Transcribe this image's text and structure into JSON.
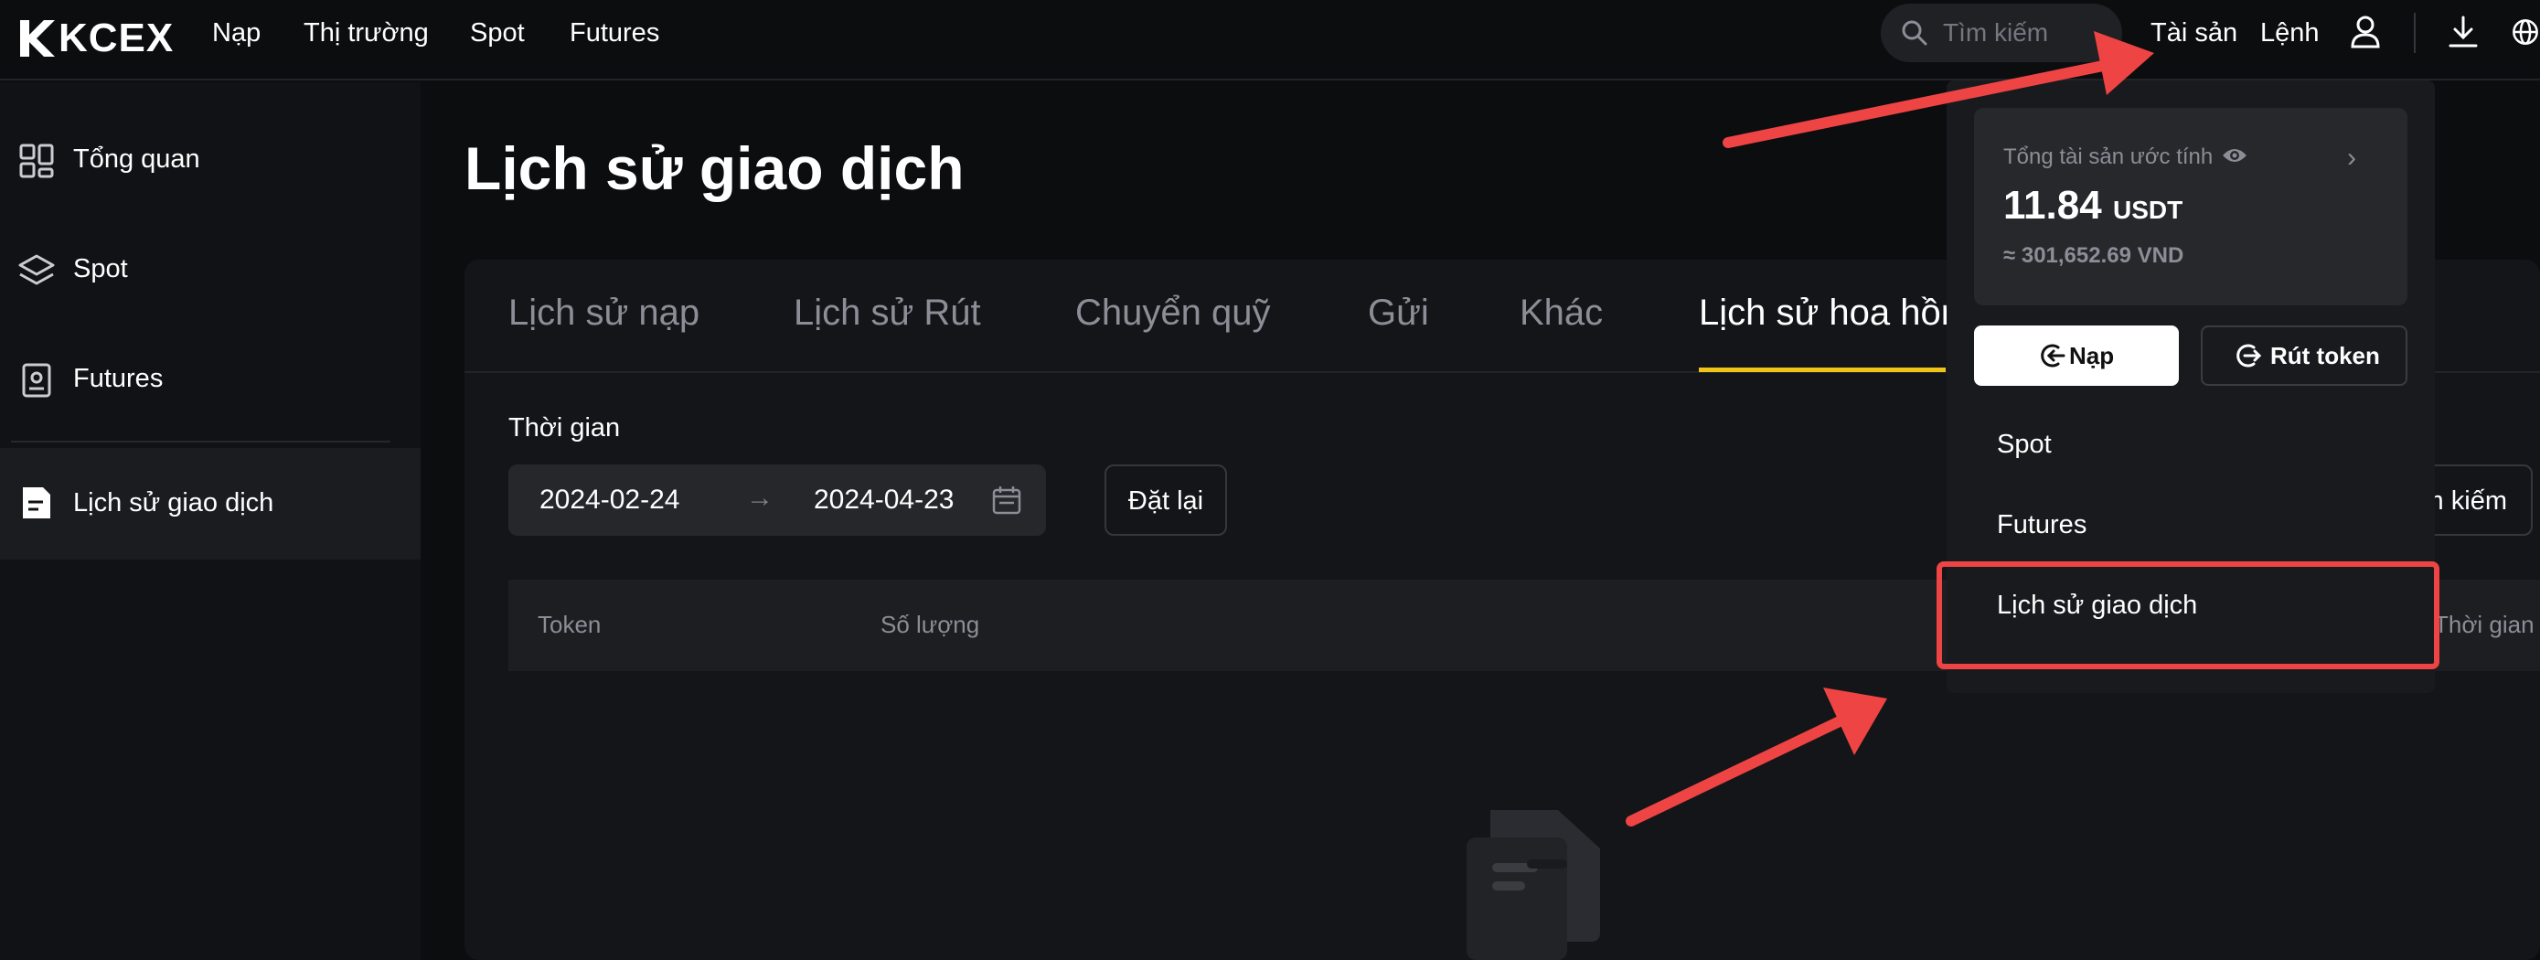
{
  "brand": {
    "name": "KCEX",
    "accent": "#f0c419"
  },
  "topnav": {
    "items": [
      "Nạp",
      "Thị trường",
      "Spot",
      "Futures"
    ],
    "search_placeholder": "Tìm kiếm",
    "assets": "Tài sản",
    "orders": "Lệnh",
    "icons": [
      "search-icon",
      "user-icon",
      "download-icon",
      "globe-icon"
    ]
  },
  "sidebar": {
    "items": [
      {
        "label": "Tổng quan",
        "icon": "grid-icon"
      },
      {
        "label": "Spot",
        "icon": "layers-icon"
      },
      {
        "label": "Futures",
        "icon": "contract-icon"
      },
      {
        "label": "Lịch sử giao dịch",
        "icon": "document-icon",
        "active": true
      }
    ]
  },
  "main": {
    "title": "Lịch sử giao dịch",
    "tabs": [
      "Lịch sử nạp",
      "Lịch sử Rút",
      "Chuyển quỹ",
      "Gửi",
      "Khác",
      "Lịch sử hoa hồng"
    ],
    "active_tab": "Lịch sử hoa hồng",
    "filter": {
      "label": "Thời gian",
      "start_date": "2024-02-24",
      "arrow": "→",
      "end_date": "2024-04-23",
      "reset_label": "Đặt lại",
      "search_label": "Tìm kiếm",
      "search_label_visible": "m kiếm"
    },
    "table": {
      "columns": [
        "Token",
        "Số lượng",
        "Thời gian"
      ]
    }
  },
  "dropdown": {
    "total_label": "Tổng tài sản ước tính",
    "total_amount": "11.84",
    "total_unit": "USDT",
    "total_vnd": "≈ 301,652.69 VND",
    "deposit_label": "Nạp",
    "withdraw_label": "Rút token",
    "items": [
      "Spot",
      "Futures",
      "Lịch sử giao dịch"
    ],
    "highlighted_item": "Lịch sử giao dịch"
  },
  "annotations": {
    "arrow_color": "#ef4444",
    "highlight_color": "#ef4444"
  }
}
